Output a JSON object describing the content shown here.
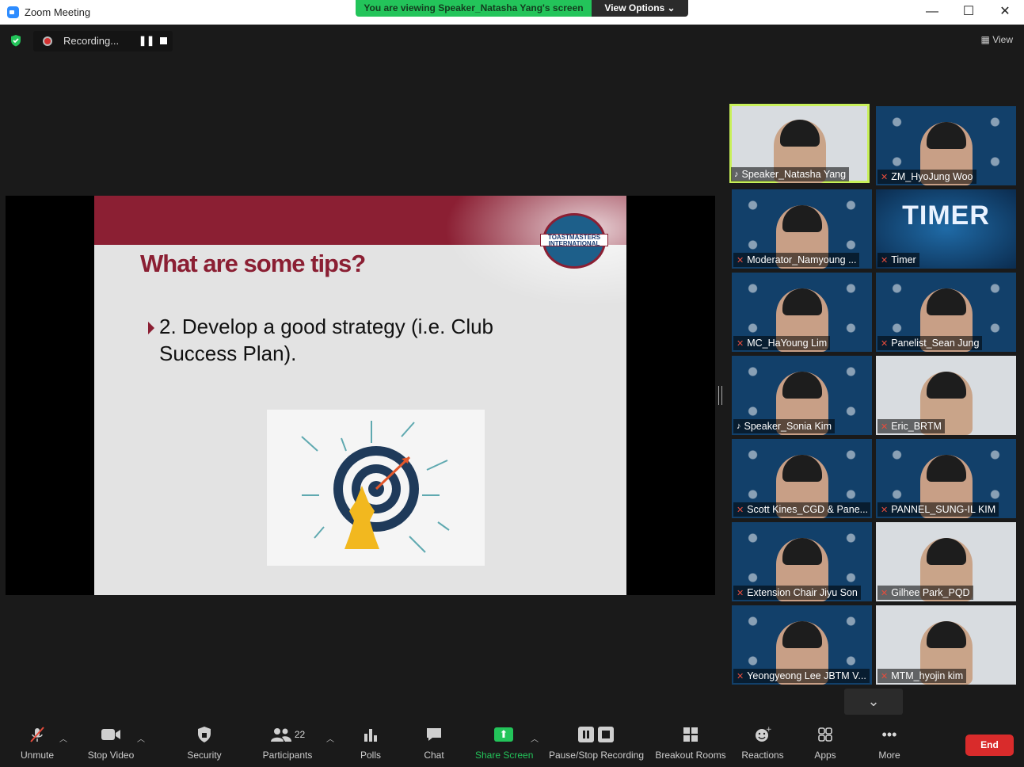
{
  "window": {
    "title": "Zoom Meeting",
    "minimize": "—",
    "maximize": "☐",
    "close": "✕"
  },
  "share_banner": {
    "text": "You are viewing Speaker_Natasha Yang's screen",
    "options_label": "View Options ⌄"
  },
  "recording": {
    "label": "Recording...",
    "pause_symbol": "❚❚"
  },
  "view_button": "▦ View",
  "slide": {
    "logo_text": "TOASTMASTERS INTERNATIONAL",
    "title": "What are some tips?",
    "bullet": "2. Develop a good strategy (i.e. Club Success Plan).",
    "colors": {
      "accent": "#8b1f33",
      "navy": "#1d3f73"
    }
  },
  "gallery": [
    {
      "name": "Speaker_Natasha Yang",
      "muted": false,
      "active": true,
      "kind": "plain"
    },
    {
      "name": "ZM_HyoJung Woo",
      "muted": true,
      "kind": "backdrop"
    },
    {
      "name": "Moderator_Namyoung ...",
      "muted": true,
      "kind": "backdrop"
    },
    {
      "name": "Timer",
      "muted": true,
      "kind": "timer",
      "overlay_text": "TIMER"
    },
    {
      "name": "MC_HaYoung Lim",
      "muted": true,
      "kind": "backdrop"
    },
    {
      "name": "Panelist_Sean Jung",
      "muted": true,
      "kind": "backdrop"
    },
    {
      "name": "Speaker_Sonia Kim",
      "muted": false,
      "kind": "backdrop"
    },
    {
      "name": "Eric_BRTM",
      "muted": true,
      "kind": "plain"
    },
    {
      "name": "Scott Kines_CGD & Pane...",
      "muted": true,
      "kind": "backdrop"
    },
    {
      "name": "PANNEL_SUNG-IL KIM",
      "muted": true,
      "kind": "backdrop"
    },
    {
      "name": "Extension Chair Jiyu Son",
      "muted": true,
      "kind": "backdrop"
    },
    {
      "name": "Gilhee Park_PQD",
      "muted": true,
      "kind": "plain"
    },
    {
      "name": "Yeongyeong Lee JBTM V...",
      "muted": true,
      "kind": "backdrop"
    },
    {
      "name": "MTM_hyojin kim",
      "muted": true,
      "kind": "plain"
    }
  ],
  "toolbar": {
    "unmute": "Unmute",
    "stop_video": "Stop Video",
    "security": "Security",
    "participants": "Participants",
    "participants_count": "22",
    "polls": "Polls",
    "chat": "Chat",
    "share_screen": "Share Screen",
    "pause_stop_recording": "Pause/Stop Recording",
    "breakout_rooms": "Breakout Rooms",
    "reactions": "Reactions",
    "apps": "Apps",
    "more": "More",
    "end": "End"
  },
  "icons": {
    "mic_off": "mic-off-icon",
    "video": "video-camera-icon",
    "security": "shield-icon",
    "participants": "people-icon",
    "polls": "bar-chart-icon",
    "chat": "chat-bubble-icon",
    "share": "share-arrow-icon",
    "recording": "record-dot-icon",
    "breakout": "grid-icon",
    "reactions": "smiley-icon",
    "apps": "apps-icon",
    "more": "ellipsis-icon"
  }
}
